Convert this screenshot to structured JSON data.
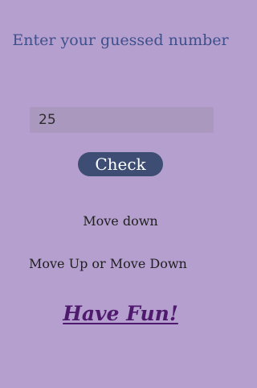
{
  "screen": {
    "title": "Enter your guessed number",
    "input_value": "25",
    "check_button_label": "Check",
    "hint_text": "Move down",
    "instruction_text": "Move Up or Move Down",
    "footer_text": "Have Fun!"
  },
  "colors": {
    "background": "#b59fcf",
    "title": "#3e4f8a",
    "button": "#3e4d74",
    "footer": "#4f1a6e"
  }
}
